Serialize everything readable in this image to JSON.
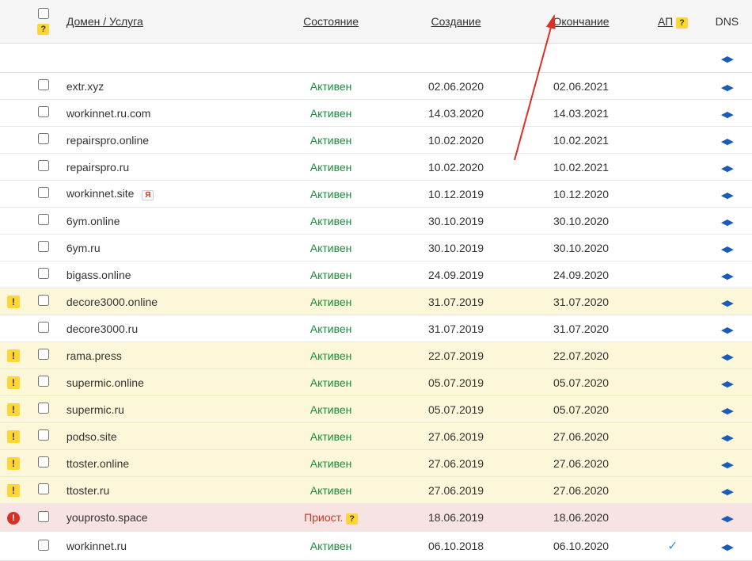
{
  "headers": {
    "domain": "Домен / Услуга",
    "status": "Состояние",
    "created": "Создание",
    "expires": "Окончание",
    "ap": "АП",
    "dns": "DNS"
  },
  "badges": {
    "help": "?",
    "yandex": "Я"
  },
  "status_labels": {
    "active": "Активен",
    "suspended": "Приост."
  },
  "rows": [
    {
      "alert": "",
      "domain": "extr.xyz",
      "ya": false,
      "status": "active",
      "created": "02.06.2020",
      "expires": "02.06.2021",
      "ap": false,
      "highlight": ""
    },
    {
      "alert": "",
      "domain": "workinnet.ru.com",
      "ya": false,
      "status": "active",
      "created": "14.03.2020",
      "expires": "14.03.2021",
      "ap": false,
      "highlight": ""
    },
    {
      "alert": "",
      "domain": "repairspro.online",
      "ya": false,
      "status": "active",
      "created": "10.02.2020",
      "expires": "10.02.2021",
      "ap": false,
      "highlight": ""
    },
    {
      "alert": "",
      "domain": "repairspro.ru",
      "ya": false,
      "status": "active",
      "created": "10.02.2020",
      "expires": "10.02.2021",
      "ap": false,
      "highlight": ""
    },
    {
      "alert": "",
      "domain": "workinnet.site",
      "ya": true,
      "status": "active",
      "created": "10.12.2019",
      "expires": "10.12.2020",
      "ap": false,
      "highlight": ""
    },
    {
      "alert": "",
      "domain": "6ym.online",
      "ya": false,
      "status": "active",
      "created": "30.10.2019",
      "expires": "30.10.2020",
      "ap": false,
      "highlight": ""
    },
    {
      "alert": "",
      "domain": "6ym.ru",
      "ya": false,
      "status": "active",
      "created": "30.10.2019",
      "expires": "30.10.2020",
      "ap": false,
      "highlight": ""
    },
    {
      "alert": "",
      "domain": "bigass.online",
      "ya": false,
      "status": "active",
      "created": "24.09.2019",
      "expires": "24.09.2020",
      "ap": false,
      "highlight": ""
    },
    {
      "alert": "yellow",
      "domain": "decore3000.online",
      "ya": false,
      "status": "active",
      "created": "31.07.2019",
      "expires": "31.07.2020",
      "ap": false,
      "highlight": "yellow"
    },
    {
      "alert": "",
      "domain": "decore3000.ru",
      "ya": false,
      "status": "active",
      "created": "31.07.2019",
      "expires": "31.07.2020",
      "ap": false,
      "highlight": ""
    },
    {
      "alert": "yellow",
      "domain": "rama.press",
      "ya": false,
      "status": "active",
      "created": "22.07.2019",
      "expires": "22.07.2020",
      "ap": false,
      "highlight": "yellow"
    },
    {
      "alert": "yellow",
      "domain": "supermic.online",
      "ya": false,
      "status": "active",
      "created": "05.07.2019",
      "expires": "05.07.2020",
      "ap": false,
      "highlight": "yellow"
    },
    {
      "alert": "yellow",
      "domain": "supermic.ru",
      "ya": false,
      "status": "active",
      "created": "05.07.2019",
      "expires": "05.07.2020",
      "ap": false,
      "highlight": "yellow"
    },
    {
      "alert": "yellow",
      "domain": "podso.site",
      "ya": false,
      "status": "active",
      "created": "27.06.2019",
      "expires": "27.06.2020",
      "ap": false,
      "highlight": "yellow"
    },
    {
      "alert": "yellow",
      "domain": "ttoster.online",
      "ya": false,
      "status": "active",
      "created": "27.06.2019",
      "expires": "27.06.2020",
      "ap": false,
      "highlight": "yellow"
    },
    {
      "alert": "yellow",
      "domain": "ttoster.ru",
      "ya": false,
      "status": "active",
      "created": "27.06.2019",
      "expires": "27.06.2020",
      "ap": false,
      "highlight": "yellow"
    },
    {
      "alert": "red",
      "domain": "youprosto.space",
      "ya": false,
      "status": "suspended",
      "created": "18.06.2019",
      "expires": "18.06.2020",
      "ap": false,
      "highlight": "red"
    },
    {
      "alert": "",
      "domain": "workinnet.ru",
      "ya": false,
      "status": "active",
      "created": "06.10.2018",
      "expires": "06.10.2020",
      "ap": true,
      "highlight": ""
    }
  ]
}
